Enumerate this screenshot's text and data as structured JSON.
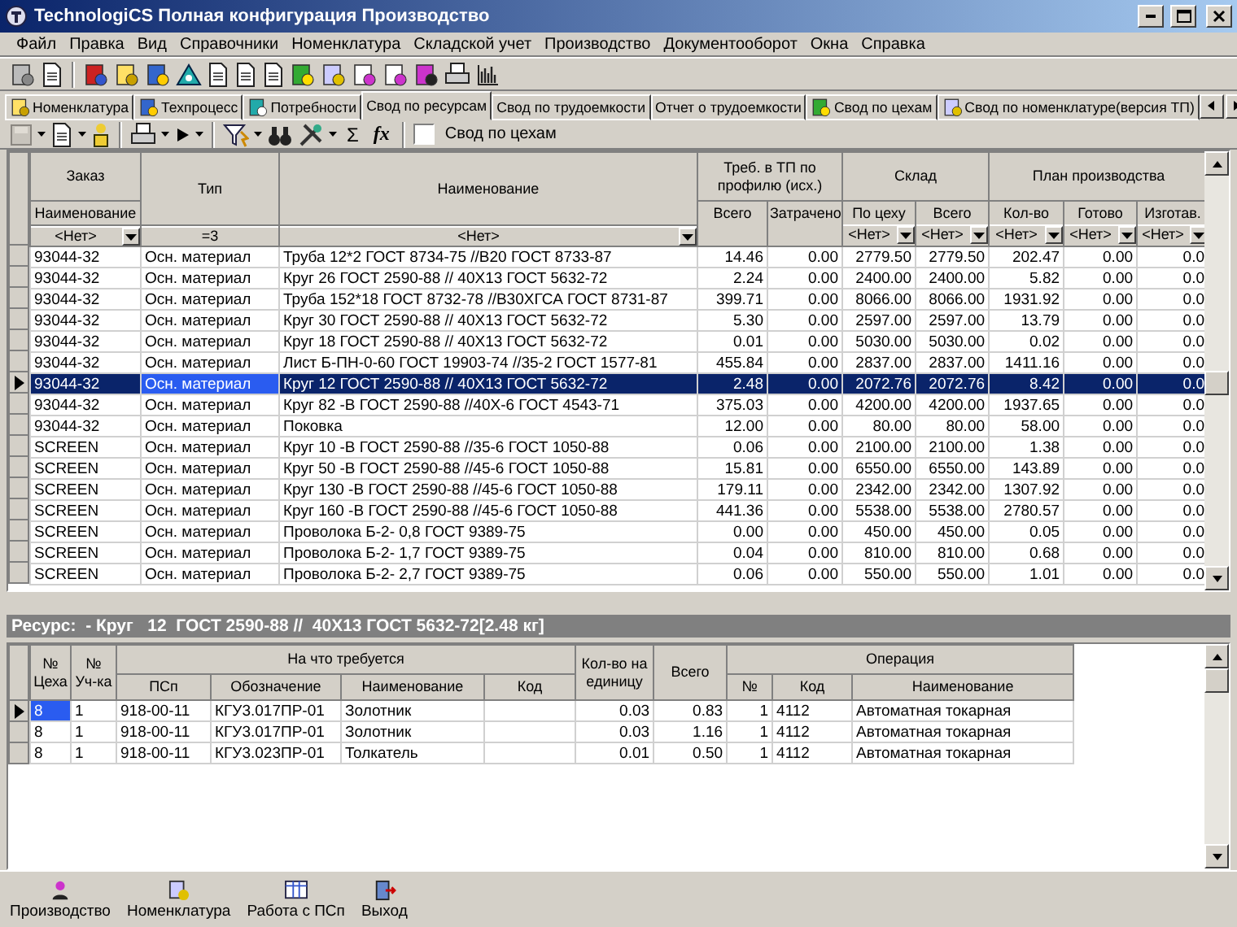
{
  "window": {
    "title": "TechnologiCS Полная конфигурация Производство"
  },
  "menu": [
    "Файл",
    "Правка",
    "Вид",
    "Справочники",
    "Номенклатура",
    "Складской учет",
    "Производство",
    "Документооборот",
    "Окна",
    "Справка"
  ],
  "tabs": [
    {
      "label": "Номенклатура",
      "selected": false,
      "icon": true
    },
    {
      "label": "Техпроцесс",
      "selected": false,
      "icon": true
    },
    {
      "label": "Потребности",
      "selected": false,
      "icon": true
    },
    {
      "label": "Свод по ресурсам",
      "selected": true,
      "icon": false
    },
    {
      "label": "Свод по трудоемкости",
      "selected": false,
      "icon": false
    },
    {
      "label": "Отчет о трудоемкости",
      "selected": false,
      "icon": false
    },
    {
      "label": "Свод по цехам",
      "selected": false,
      "icon": true
    },
    {
      "label": "Свод по номенклатуре(версия ТП)",
      "selected": false,
      "icon": true
    }
  ],
  "toolbar": {
    "symbols": [
      "Σ",
      "fx"
    ],
    "checkbox": {
      "label": "Свод по цехам",
      "checked": false
    }
  },
  "main_grid": {
    "columns": [
      {
        "kind": "stacked",
        "header": "Заказ",
        "subheader": "Наименование",
        "filter": "<Нет>",
        "dropdown": true
      },
      {
        "kind": "plain",
        "header": "Тип",
        "filter": "=3",
        "dropdown": false
      },
      {
        "kind": "plain",
        "header": "Наименование",
        "filter": "<Нет>",
        "dropdown": true
      },
      {
        "kind": "group",
        "header": "Треб. в ТП по профилю (исх.)",
        "colspan": 2,
        "children": [
          {
            "header": "Всего"
          },
          {
            "header": "Затрачено"
          }
        ]
      },
      {
        "kind": "group",
        "header": "Склад",
        "colspan": 2,
        "children": [
          {
            "header": "По цеху",
            "filter": "<Нет>",
            "dropdown": true
          },
          {
            "header": "Всего",
            "filter": "<Нет>",
            "dropdown": true
          }
        ]
      },
      {
        "kind": "group",
        "header": "План производства",
        "colspan": 3,
        "children": [
          {
            "header": "Кол-во",
            "filter": "<Нет>",
            "dropdown": true
          },
          {
            "header": "Готово",
            "filter": "<Нет>",
            "dropdown": true
          },
          {
            "header": "Изготав.",
            "filter": "<Нет>",
            "dropdown": true
          }
        ]
      }
    ],
    "rows": [
      {
        "selected": false,
        "cells": [
          "93044-32",
          "Осн. материал",
          "Труба  12*2  ГОСТ 8734-75 //В20 ГОСТ 8733-87",
          "14.46",
          "0.00",
          "2779.50",
          "2779.50",
          "202.47",
          "0.00",
          "0.0"
        ]
      },
      {
        "selected": false,
        "cells": [
          "93044-32",
          "Осн. материал",
          "Круг  26  ГОСТ 2590-88 //  40Х13 ГОСТ 5632-72",
          "2.24",
          "0.00",
          "2400.00",
          "2400.00",
          "5.82",
          "0.00",
          "0.0"
        ]
      },
      {
        "selected": false,
        "cells": [
          "93044-32",
          "Осн. материал",
          "Труба  152*18  ГОСТ 8732-78 //В30ХГСА ГОСТ 8731-87",
          "399.71",
          "0.00",
          "8066.00",
          "8066.00",
          "1931.92",
          "0.00",
          "0.0"
        ]
      },
      {
        "selected": false,
        "cells": [
          "93044-32",
          "Осн. материал",
          "Круг  30  ГОСТ 2590-88 //  40Х13 ГОСТ 5632-72",
          "5.30",
          "0.00",
          "2597.00",
          "2597.00",
          "13.79",
          "0.00",
          "0.0"
        ]
      },
      {
        "selected": false,
        "cells": [
          "93044-32",
          "Осн. материал",
          "Круг  18  ГОСТ 2590-88 //  40Х13 ГОСТ 5632-72",
          "0.01",
          "0.00",
          "5030.00",
          "5030.00",
          "0.02",
          "0.00",
          "0.0"
        ]
      },
      {
        "selected": false,
        "cells": [
          "93044-32",
          "Осн. материал",
          "Лист Б-ПН-0-60 ГОСТ 19903-74 //35-2 ГОСТ 1577-81",
          "455.84",
          "0.00",
          "2837.00",
          "2837.00",
          "1411.16",
          "0.00",
          "0.0"
        ]
      },
      {
        "selected": true,
        "cells": [
          "93044-32",
          "Осн. материал",
          "Круг  12  ГОСТ 2590-88 //  40Х13 ГОСТ 5632-72",
          "2.48",
          "0.00",
          "2072.76",
          "2072.76",
          "8.42",
          "0.00",
          "0.0"
        ]
      },
      {
        "selected": false,
        "cells": [
          "93044-32",
          "Осн. материал",
          "Круг  82  -В ГОСТ 2590-88 //40Х-6 ГОСТ 4543-71",
          "375.03",
          "0.00",
          "4200.00",
          "4200.00",
          "1937.65",
          "0.00",
          "0.0"
        ]
      },
      {
        "selected": false,
        "cells": [
          "93044-32",
          "Осн. материал",
          "Поковка",
          "12.00",
          "0.00",
          "80.00",
          "80.00",
          "58.00",
          "0.00",
          "0.0"
        ]
      },
      {
        "selected": false,
        "cells": [
          "SCREEN",
          "Осн. материал",
          "Круг   10  -В ГОСТ 2590-88 //35-6 ГОСТ 1050-88",
          "0.06",
          "0.00",
          "2100.00",
          "2100.00",
          "1.38",
          "0.00",
          "0.0"
        ]
      },
      {
        "selected": false,
        "cells": [
          "SCREEN",
          "Осн. материал",
          "Круг   50  -В ГОСТ 2590-88 //45-6 ГОСТ 1050-88",
          "15.81",
          "0.00",
          "6550.00",
          "6550.00",
          "143.89",
          "0.00",
          "0.0"
        ]
      },
      {
        "selected": false,
        "cells": [
          "SCREEN",
          "Осн. материал",
          "Круг  130  -В ГОСТ 2590-88 //45-6 ГОСТ 1050-88",
          "179.11",
          "0.00",
          "2342.00",
          "2342.00",
          "1307.92",
          "0.00",
          "0.0"
        ]
      },
      {
        "selected": false,
        "cells": [
          "SCREEN",
          "Осн. материал",
          "Круг  160  -В ГОСТ 2590-88 //45-6 ГОСТ 1050-88",
          "441.36",
          "0.00",
          "5538.00",
          "5538.00",
          "2780.57",
          "0.00",
          "0.0"
        ]
      },
      {
        "selected": false,
        "cells": [
          "SCREEN",
          "Осн. материал",
          "Проволока Б-2- 0,8   ГОСТ 9389-75",
          "0.00",
          "0.00",
          "450.00",
          "450.00",
          "0.05",
          "0.00",
          "0.0"
        ]
      },
      {
        "selected": false,
        "cells": [
          "SCREEN",
          "Осн. материал",
          "Проволока Б-2- 1,7  ГОСТ 9389-75",
          "0.04",
          "0.00",
          "810.00",
          "810.00",
          "0.68",
          "0.00",
          "0.0"
        ]
      },
      {
        "selected": false,
        "cells": [
          "SCREEN",
          "Осн. материал",
          "Проволока Б-2- 2,7   ГОСТ 9389-75",
          "0.06",
          "0.00",
          "550.00",
          "550.00",
          "1.01",
          "0.00",
          "0.0"
        ]
      }
    ]
  },
  "resource_bar": "Ресурс:  - Круг   12  ГОСТ 2590-88 //  40Х13 ГОСТ 5632-72[2.48 кг]",
  "detail_grid": {
    "columns": [
      {
        "kind": "plain",
        "header": "№ Цеха"
      },
      {
        "kind": "plain",
        "header": "№ Уч-ка"
      },
      {
        "kind": "group",
        "header": "На что требуется",
        "colspan": 4,
        "children": [
          {
            "header": "ПСп"
          },
          {
            "header": "Обозначение"
          },
          {
            "header": "Наименование"
          },
          {
            "header": "Код"
          }
        ]
      },
      {
        "kind": "plain",
        "header": "Кол-во на единицу"
      },
      {
        "kind": "plain",
        "header": "Всего"
      },
      {
        "kind": "group",
        "header": "Операция",
        "colspan": 3,
        "children": [
          {
            "header": "№"
          },
          {
            "header": "Код"
          },
          {
            "header": "Наименование"
          }
        ]
      }
    ],
    "rows": [
      {
        "selected": true,
        "cells": [
          "8",
          "1",
          "918-00-11",
          "КГУ3.017ПР-01",
          "Золотник",
          "",
          "0.03",
          "0.83",
          "1",
          "4112",
          "Автоматная токарная"
        ]
      },
      {
        "selected": false,
        "cells": [
          "8",
          "1",
          "918-00-11",
          "КГУ3.017ПР-01",
          "Золотник",
          "",
          "0.03",
          "1.16",
          "1",
          "4112",
          "Автоматная токарная"
        ]
      },
      {
        "selected": false,
        "cells": [
          "8",
          "1",
          "918-00-11",
          "КГУ3.023ПР-01",
          "Толкатель",
          "",
          "0.01",
          "0.50",
          "1",
          "4112",
          "Автоматная токарная"
        ]
      }
    ]
  },
  "shortcuts": [
    {
      "label": "Производство"
    },
    {
      "label": "Номенклатура"
    },
    {
      "label": "Работа с ПСп"
    },
    {
      "label": "Выход"
    }
  ]
}
